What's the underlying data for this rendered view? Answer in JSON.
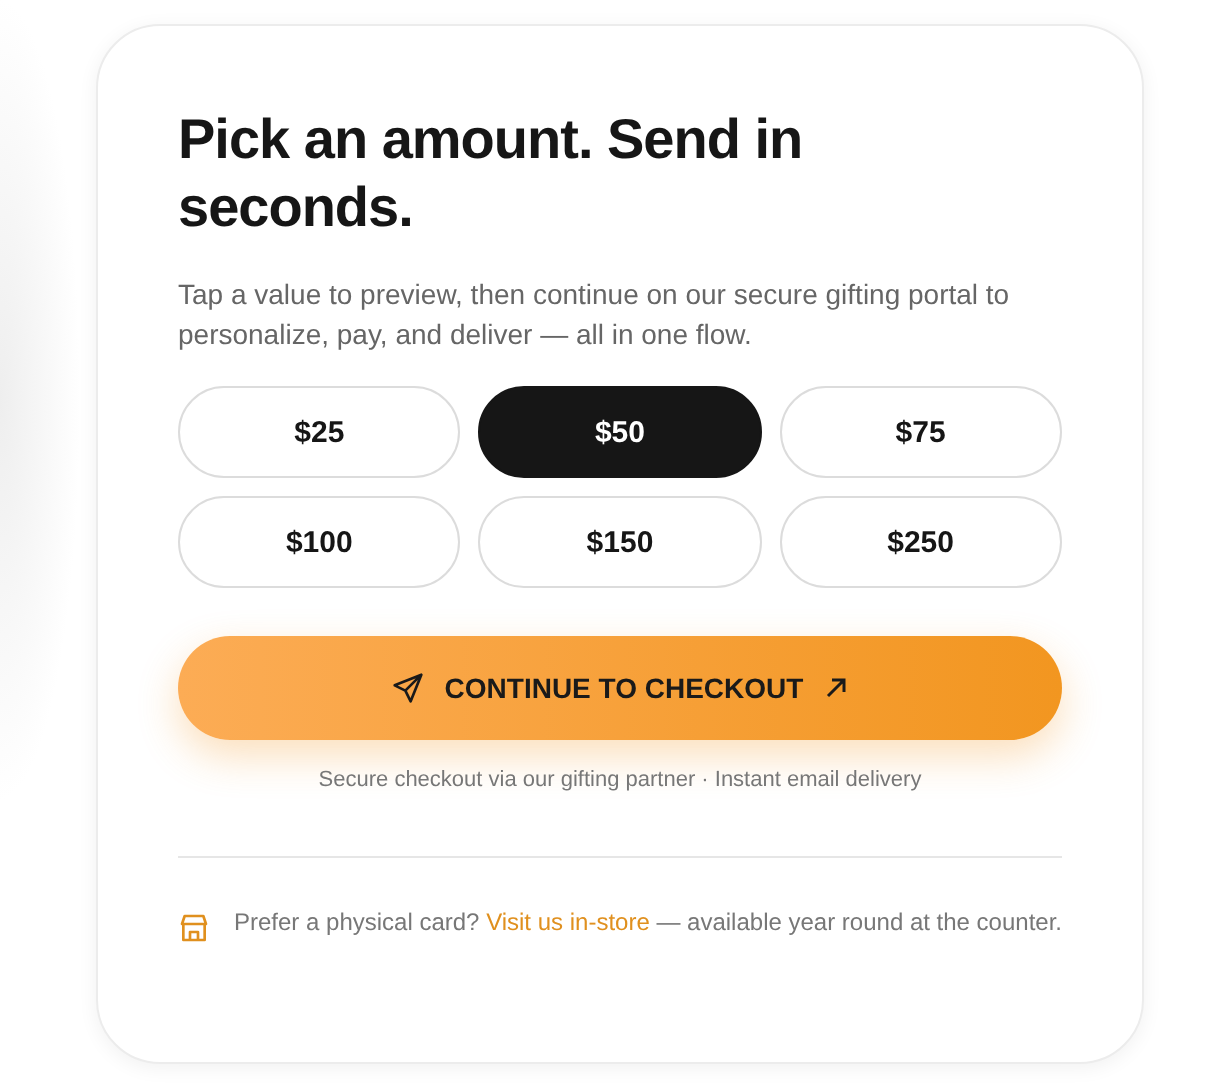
{
  "card": {
    "title": "Pick an amount. Send in seconds.",
    "description": "Tap a value to preview, then continue on our secure gifting portal to personalize, pay, and deliver — all in one flow.",
    "amounts": [
      {
        "label": "$25",
        "selected": false
      },
      {
        "label": "$50",
        "selected": true
      },
      {
        "label": "$75",
        "selected": false
      },
      {
        "label": "$100",
        "selected": false
      },
      {
        "label": "$150",
        "selected": false
      },
      {
        "label": "$250",
        "selected": false
      }
    ],
    "checkout_button": "CONTINUE TO CHECKOUT",
    "note": "Secure checkout via our gifting partner · Instant email delivery",
    "store_note": {
      "before": "Prefer a physical card? ",
      "link": "Visit us in-store",
      "after": " — available year round at the counter."
    }
  }
}
